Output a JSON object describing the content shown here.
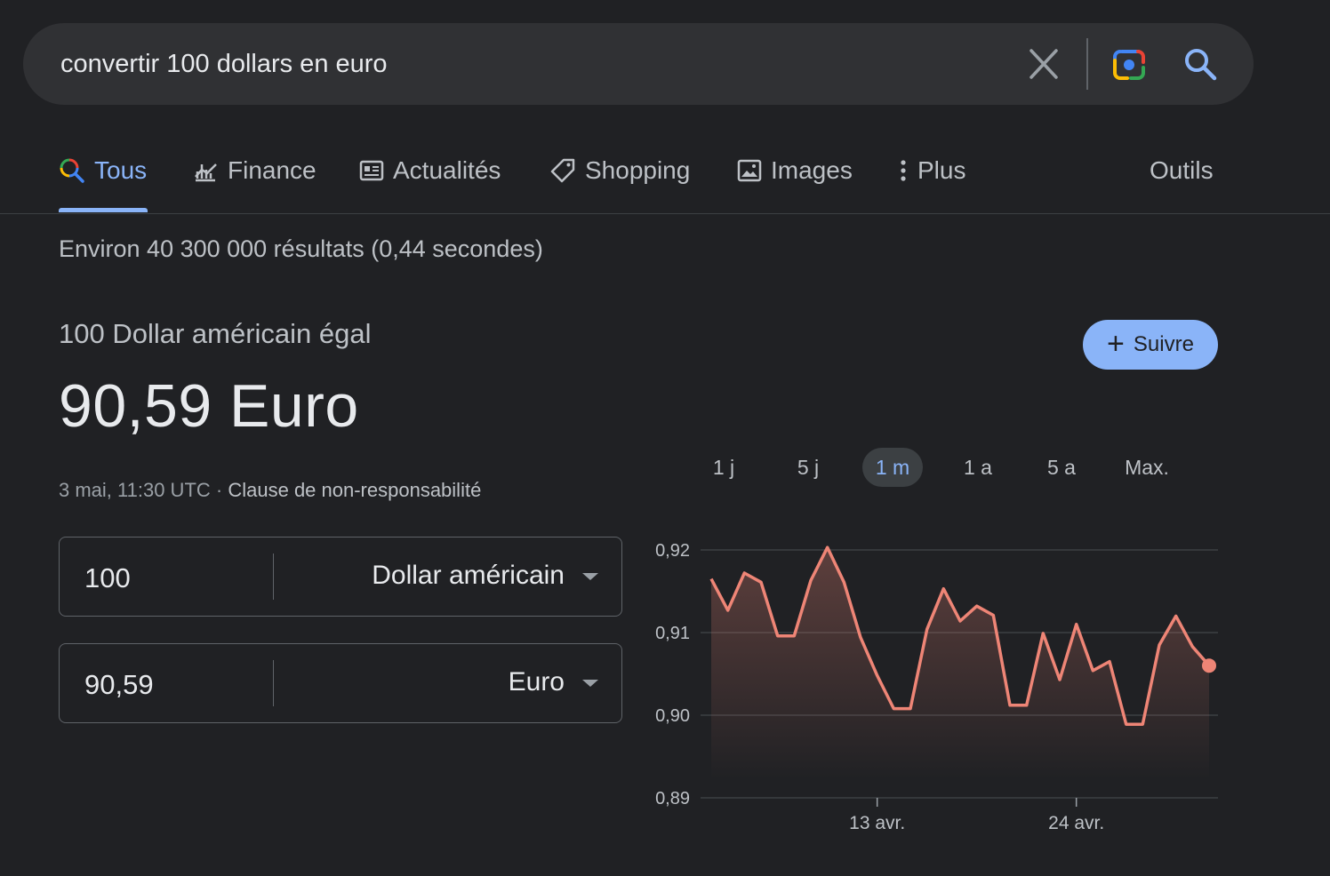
{
  "search": {
    "query": "convertir 100 dollars en euro",
    "clear_icon": "close-icon",
    "lens_icon": "camera-lens-icon",
    "search_icon": "search-icon"
  },
  "tabs": [
    {
      "label": "Tous",
      "icon": "search-icon",
      "active": true
    },
    {
      "label": "Finance",
      "icon": "finance-chart-icon",
      "active": false
    },
    {
      "label": "Actualités",
      "icon": "news-icon",
      "active": false
    },
    {
      "label": "Shopping",
      "icon": "tag-icon",
      "active": false
    },
    {
      "label": "Images",
      "icon": "image-icon",
      "active": false
    },
    {
      "label": "Plus",
      "icon": "more-vert-icon",
      "active": false
    }
  ],
  "tools_label": "Outils",
  "stats": "Environ 40 300 000 résultats (0,44 secondes)",
  "conversion": {
    "label": "100 Dollar américain égal",
    "result": "90,59 Euro",
    "timestamp": "3 mai, 11:30 UTC",
    "separator": " · ",
    "disclaimer": "Clause de non-responsabilité",
    "follow_label": "Suivre",
    "from": {
      "amount": "100",
      "currency": "Dollar américain"
    },
    "to": {
      "amount": "90,59",
      "currency": "Euro"
    }
  },
  "ranges": [
    {
      "label": "1 j",
      "active": false
    },
    {
      "label": "5 j",
      "active": false
    },
    {
      "label": "1 m",
      "active": true
    },
    {
      "label": "1 a",
      "active": false
    },
    {
      "label": "5 a",
      "active": false
    },
    {
      "label": "Max.",
      "active": false
    }
  ],
  "colors": {
    "accent": "#8ab4f8",
    "line": "#ee8576",
    "background": "#202124"
  },
  "chart_data": {
    "type": "area",
    "title": "",
    "xlabel": "",
    "ylabel": "",
    "ylim": [
      0.89,
      0.92
    ],
    "yticks": [
      0.92,
      0.91,
      0.9,
      0.89
    ],
    "ytick_labels": [
      "0,92",
      "0,91",
      "0,90",
      "0,89"
    ],
    "xticks": [
      {
        "label": "13 avr.",
        "index": 10
      },
      {
        "label": "24 avr.",
        "index": 22
      }
    ],
    "grid": true,
    "series": [
      {
        "values": [
          0.9165,
          0.9127,
          0.9172,
          0.9161,
          0.9096,
          0.9096,
          0.9163,
          0.9203,
          0.9161,
          0.9094,
          0.9048,
          0.9008,
          0.9008,
          0.9104,
          0.9153,
          0.9114,
          0.9132,
          0.9121,
          0.9012,
          0.9012,
          0.9099,
          0.9043,
          0.911,
          0.9054,
          0.9065,
          0.8989,
          0.8989,
          0.9085,
          0.912,
          0.9083,
          0.906
        ]
      }
    ],
    "last_point_marker": true
  }
}
